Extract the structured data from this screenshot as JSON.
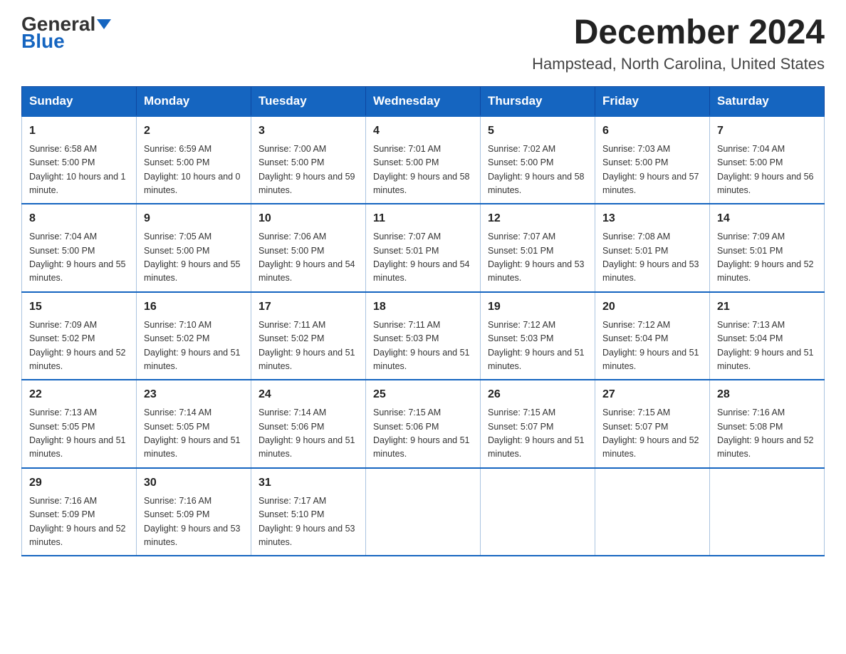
{
  "header": {
    "logo": {
      "general": "General",
      "blue": "Blue"
    },
    "month_title": "December 2024",
    "location": "Hampstead, North Carolina, United States"
  },
  "days_of_week": [
    "Sunday",
    "Monday",
    "Tuesday",
    "Wednesday",
    "Thursday",
    "Friday",
    "Saturday"
  ],
  "weeks": [
    [
      {
        "day": "1",
        "sunrise": "6:58 AM",
        "sunset": "5:00 PM",
        "daylight": "10 hours and 1 minute."
      },
      {
        "day": "2",
        "sunrise": "6:59 AM",
        "sunset": "5:00 PM",
        "daylight": "10 hours and 0 minutes."
      },
      {
        "day": "3",
        "sunrise": "7:00 AM",
        "sunset": "5:00 PM",
        "daylight": "9 hours and 59 minutes."
      },
      {
        "day": "4",
        "sunrise": "7:01 AM",
        "sunset": "5:00 PM",
        "daylight": "9 hours and 58 minutes."
      },
      {
        "day": "5",
        "sunrise": "7:02 AM",
        "sunset": "5:00 PM",
        "daylight": "9 hours and 58 minutes."
      },
      {
        "day": "6",
        "sunrise": "7:03 AM",
        "sunset": "5:00 PM",
        "daylight": "9 hours and 57 minutes."
      },
      {
        "day": "7",
        "sunrise": "7:04 AM",
        "sunset": "5:00 PM",
        "daylight": "9 hours and 56 minutes."
      }
    ],
    [
      {
        "day": "8",
        "sunrise": "7:04 AM",
        "sunset": "5:00 PM",
        "daylight": "9 hours and 55 minutes."
      },
      {
        "day": "9",
        "sunrise": "7:05 AM",
        "sunset": "5:00 PM",
        "daylight": "9 hours and 55 minutes."
      },
      {
        "day": "10",
        "sunrise": "7:06 AM",
        "sunset": "5:00 PM",
        "daylight": "9 hours and 54 minutes."
      },
      {
        "day": "11",
        "sunrise": "7:07 AM",
        "sunset": "5:01 PM",
        "daylight": "9 hours and 54 minutes."
      },
      {
        "day": "12",
        "sunrise": "7:07 AM",
        "sunset": "5:01 PM",
        "daylight": "9 hours and 53 minutes."
      },
      {
        "day": "13",
        "sunrise": "7:08 AM",
        "sunset": "5:01 PM",
        "daylight": "9 hours and 53 minutes."
      },
      {
        "day": "14",
        "sunrise": "7:09 AM",
        "sunset": "5:01 PM",
        "daylight": "9 hours and 52 minutes."
      }
    ],
    [
      {
        "day": "15",
        "sunrise": "7:09 AM",
        "sunset": "5:02 PM",
        "daylight": "9 hours and 52 minutes."
      },
      {
        "day": "16",
        "sunrise": "7:10 AM",
        "sunset": "5:02 PM",
        "daylight": "9 hours and 51 minutes."
      },
      {
        "day": "17",
        "sunrise": "7:11 AM",
        "sunset": "5:02 PM",
        "daylight": "9 hours and 51 minutes."
      },
      {
        "day": "18",
        "sunrise": "7:11 AM",
        "sunset": "5:03 PM",
        "daylight": "9 hours and 51 minutes."
      },
      {
        "day": "19",
        "sunrise": "7:12 AM",
        "sunset": "5:03 PM",
        "daylight": "9 hours and 51 minutes."
      },
      {
        "day": "20",
        "sunrise": "7:12 AM",
        "sunset": "5:04 PM",
        "daylight": "9 hours and 51 minutes."
      },
      {
        "day": "21",
        "sunrise": "7:13 AM",
        "sunset": "5:04 PM",
        "daylight": "9 hours and 51 minutes."
      }
    ],
    [
      {
        "day": "22",
        "sunrise": "7:13 AM",
        "sunset": "5:05 PM",
        "daylight": "9 hours and 51 minutes."
      },
      {
        "day": "23",
        "sunrise": "7:14 AM",
        "sunset": "5:05 PM",
        "daylight": "9 hours and 51 minutes."
      },
      {
        "day": "24",
        "sunrise": "7:14 AM",
        "sunset": "5:06 PM",
        "daylight": "9 hours and 51 minutes."
      },
      {
        "day": "25",
        "sunrise": "7:15 AM",
        "sunset": "5:06 PM",
        "daylight": "9 hours and 51 minutes."
      },
      {
        "day": "26",
        "sunrise": "7:15 AM",
        "sunset": "5:07 PM",
        "daylight": "9 hours and 51 minutes."
      },
      {
        "day": "27",
        "sunrise": "7:15 AM",
        "sunset": "5:07 PM",
        "daylight": "9 hours and 52 minutes."
      },
      {
        "day": "28",
        "sunrise": "7:16 AM",
        "sunset": "5:08 PM",
        "daylight": "9 hours and 52 minutes."
      }
    ],
    [
      {
        "day": "29",
        "sunrise": "7:16 AM",
        "sunset": "5:09 PM",
        "daylight": "9 hours and 52 minutes."
      },
      {
        "day": "30",
        "sunrise": "7:16 AM",
        "sunset": "5:09 PM",
        "daylight": "9 hours and 53 minutes."
      },
      {
        "day": "31",
        "sunrise": "7:17 AM",
        "sunset": "5:10 PM",
        "daylight": "9 hours and 53 minutes."
      },
      null,
      null,
      null,
      null
    ]
  ]
}
